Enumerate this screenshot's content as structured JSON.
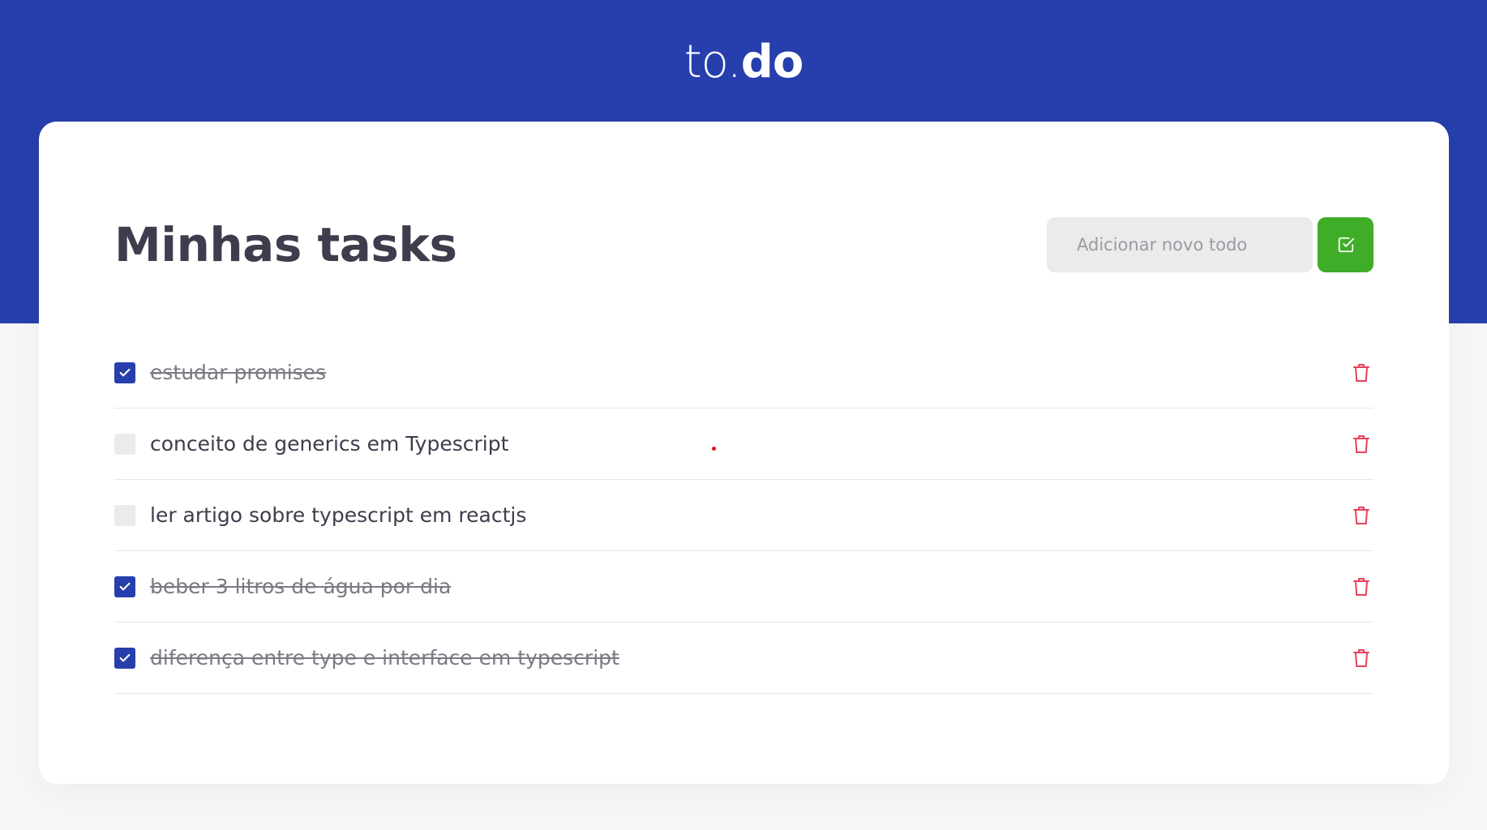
{
  "header": {
    "logo_light": "to.",
    "logo_bold": "do"
  },
  "main": {
    "title": "Minhas tasks",
    "new_task_placeholder": "Adicionar novo todo",
    "new_task_value": "",
    "add_button_icon": "check-square-icon"
  },
  "tasks": [
    {
      "text": "estudar promises",
      "done": true
    },
    {
      "text": "conceito de generics em Typescript",
      "done": false
    },
    {
      "text": "ler artigo sobre typescript em reactjs",
      "done": false
    },
    {
      "text": "beber 3 litros de água por dia",
      "done": true
    },
    {
      "text": "diferença entre type e interface em typescript",
      "done": true
    }
  ],
  "icons": {
    "checkbox_check": "check-icon",
    "delete": "trash-icon"
  },
  "colors": {
    "brand_blue": "#273fad",
    "add_green": "#3fad27",
    "delete_red": "#e83f5b",
    "text_dark": "#3d3d4d"
  }
}
